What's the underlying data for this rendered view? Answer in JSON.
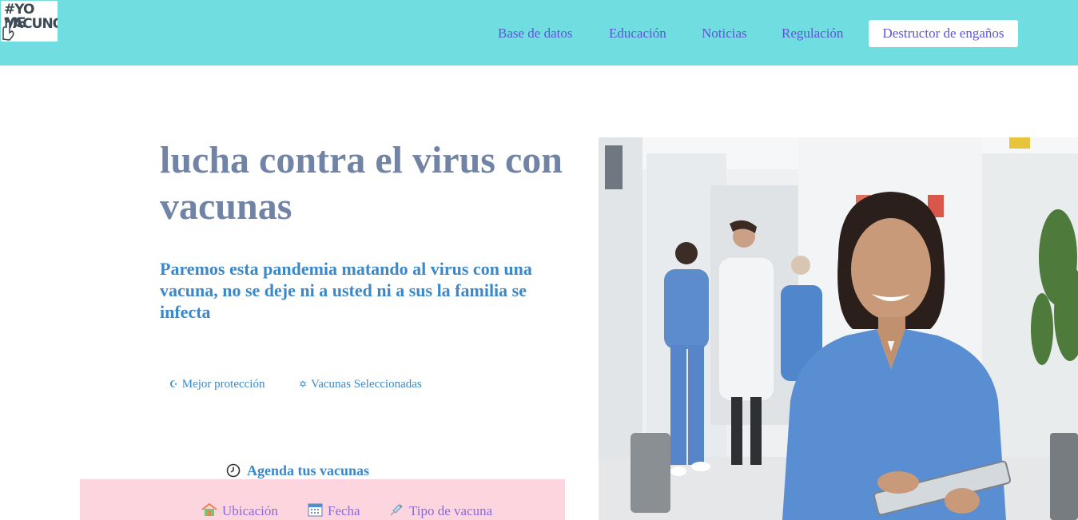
{
  "brand": {
    "logo_line1": "#YO ME",
    "logo_line2": "VACUNO"
  },
  "nav": {
    "items": [
      "Base de datos",
      "Educación",
      "Noticias",
      "Regulación"
    ],
    "cta": "Destructor de engaños"
  },
  "hero": {
    "title": "lucha contra el virus con vacunas",
    "subtitle": "Paremos esta pandemia matando al virus con una vacuna, no se deje ni a usted ni a sus la familia se infecta"
  },
  "features": [
    {
      "icon": "moon-icon",
      "glyph": "☪",
      "label": "Mejor protección"
    },
    {
      "icon": "star-of-david-icon",
      "glyph": "✡",
      "label": "Vacunas Seleccionadas"
    }
  ],
  "agenda": {
    "icon": "clock-icon",
    "title": "Agenda tus vacunas"
  },
  "booking": {
    "location": "Ubicación",
    "date": "Fecha",
    "vaccine_type": "Tipo de vacuna"
  },
  "colors": {
    "header_bg": "#70dde0",
    "nav_text": "#5b57d6",
    "title": "#7284a6",
    "accent_blue": "#3a88cc",
    "booking_bg": "#fdd5de",
    "booking_text": "#8a6ad8"
  }
}
